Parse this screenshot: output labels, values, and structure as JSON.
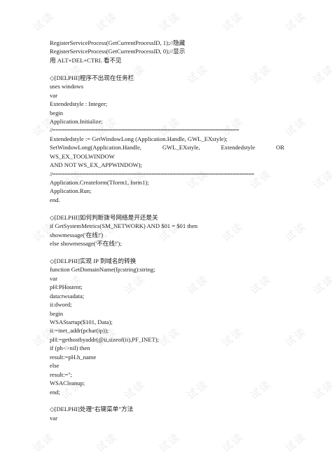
{
  "watermark": {
    "text": "试读"
  },
  "document": {
    "lines": [
      {
        "type": "text",
        "text": "RegisterServiceProcess(GetCurrentProcessID, 1);//隐藏"
      },
      {
        "type": "text",
        "text": "RegisterServiceProcess(GetCurrentProcessID, 0);//显示"
      },
      {
        "type": "text",
        "text": "用 ALT+DEL+CTRL 看不见"
      },
      {
        "type": "gap"
      },
      {
        "type": "text",
        "text": "◇[DELPHI]程序不出现在任务栏"
      },
      {
        "type": "text",
        "text": "uses windows"
      },
      {
        "type": "text",
        "text": "var"
      },
      {
        "type": "text",
        "text": "Extendedstyle : Integer;"
      },
      {
        "type": "text",
        "text": "begin"
      },
      {
        "type": "text",
        "text": "Application.Initialize;"
      },
      {
        "type": "rule",
        "text": "//=============================================================="
      },
      {
        "type": "text",
        "text": "Extendedstyle := GetWindowLong (Application.Handle, GWL_EXstyle);"
      },
      {
        "type": "justified",
        "parts": [
          "SetWindowLong(Application.Handle,",
          "GWL_EXstyle,",
          "Extendedstyle",
          "OR"
        ]
      },
      {
        "type": "text",
        "text": "WS_EX_TOOLWINDOW"
      },
      {
        "type": "text",
        "text": "AND NOT WS_EX_APPWINDOW);"
      },
      {
        "type": "rule",
        "text": "//==================================================================="
      },
      {
        "type": "text",
        "text": "Application.Createform(Tform1, form1);"
      },
      {
        "type": "text",
        "text": "Application.Run;"
      },
      {
        "type": "text",
        "text": "end."
      },
      {
        "type": "gap"
      },
      {
        "type": "text",
        "text": "◇[DELPHI]如何判断拨号网络是开还是关"
      },
      {
        "type": "text",
        "text": "if GetSystemMetrics(SM_NETWORK) AND $01 = $01 then"
      },
      {
        "type": "text",
        "text": "showmessage('在线!')"
      },
      {
        "type": "text",
        "text": "else showmessage('不在线!');"
      },
      {
        "type": "gap"
      },
      {
        "type": "text",
        "text": "◇[DELPHI]实现 IP 到域名的转换"
      },
      {
        "type": "text",
        "text": "function GetDomainName(Ip:string):string;"
      },
      {
        "type": "text",
        "text": "var"
      },
      {
        "type": "text",
        "text": "pH:PHostent;"
      },
      {
        "type": "text",
        "text": "data:twsadata;"
      },
      {
        "type": "text",
        "text": "ii:dword;"
      },
      {
        "type": "text",
        "text": "begin"
      },
      {
        "type": "text",
        "text": "WSAStartup($101, Data);"
      },
      {
        "type": "text",
        "text": "ii:=inet_addr(pchar(ip));"
      },
      {
        "type": "text",
        "text": "pH:=gethostbyaddr(@ii,sizeof(ii),PF_INET);"
      },
      {
        "type": "text",
        "text": "if (ph<>nil) then"
      },
      {
        "type": "text",
        "text": "result:=pH.h_name"
      },
      {
        "type": "text",
        "text": "else"
      },
      {
        "type": "text",
        "text": "result:='';"
      },
      {
        "type": "text",
        "text": "WSACleanup;"
      },
      {
        "type": "text",
        "text": "end;"
      },
      {
        "type": "gap"
      },
      {
        "type": "text",
        "text": "◇[DELPHI]处理“右键菜单”方法"
      },
      {
        "type": "text",
        "text": "var"
      }
    ]
  }
}
